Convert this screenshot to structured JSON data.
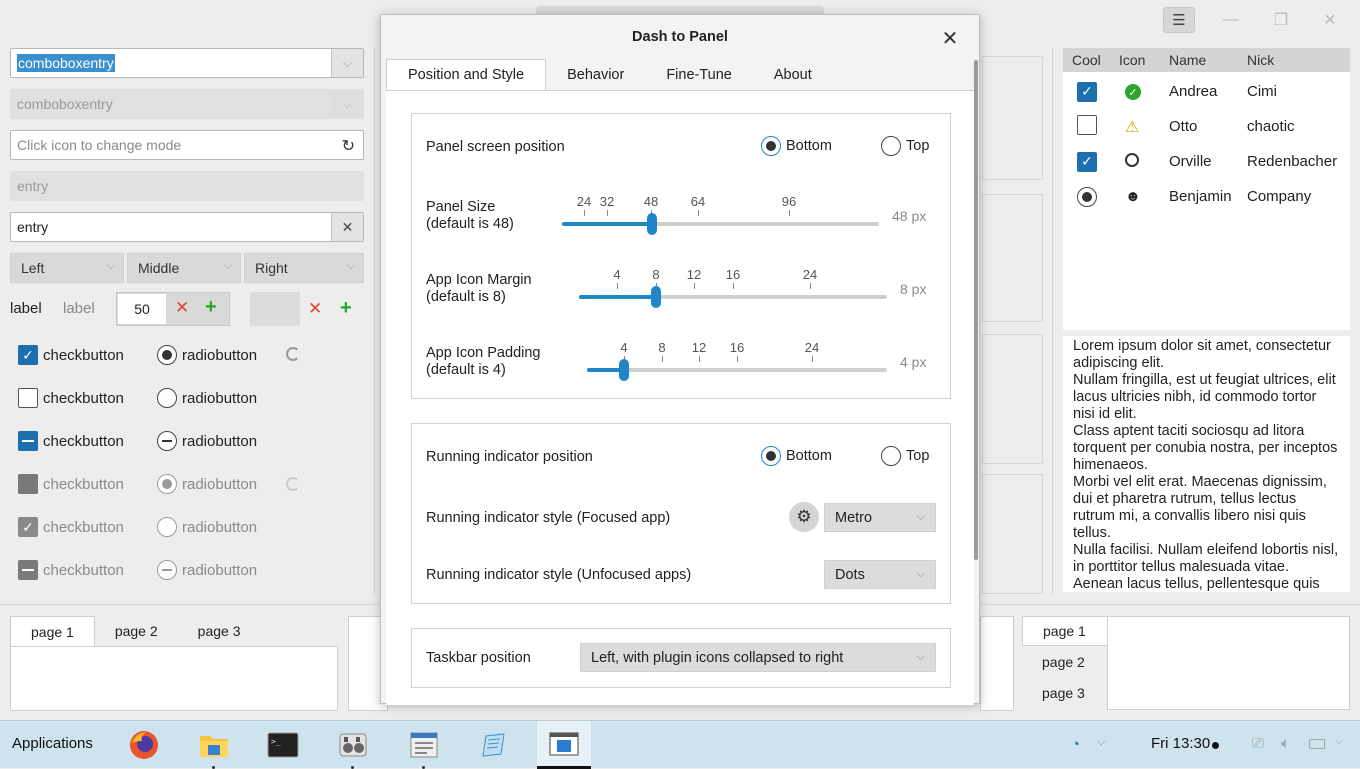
{
  "background_window": {
    "left_panel": {
      "combo_entry_1": "comboboxentry",
      "combo_entry_2": "comboboxentry",
      "mode_entry_placeholder": "Click icon to change mode",
      "entry_disabled": "entry",
      "entry_clear": "entry",
      "segments": [
        "Left",
        "Middle",
        "Right"
      ],
      "label_1": "label",
      "label_2": "label",
      "spin_value": "50",
      "checkbutton_label": "checkbutton",
      "radiobutton_label": "radiobutton"
    },
    "bottom_notebook_left": {
      "tabs": [
        "page 1",
        "page 2",
        "page 3"
      ]
    },
    "bottom_notebook_right": {
      "tabs": [
        "page 1",
        "page 2",
        "page 3"
      ]
    },
    "tree": {
      "columns": [
        "Cool",
        "Icon",
        "Name",
        "Nick"
      ],
      "rows": [
        {
          "name": "Andrea",
          "nick": "Cimi",
          "icon": "ok-icon"
        },
        {
          "name": "Otto",
          "nick": "chaotic",
          "icon": "warning-icon"
        },
        {
          "name": "Orville",
          "nick": "Redenbacher",
          "icon": "user-icon"
        },
        {
          "name": "Benjamin",
          "nick": "Company",
          "icon": "face-icon"
        }
      ]
    },
    "text_view": "Lorem ipsum dolor sit amet, consectetur adipiscing elit.\nNullam fringilla, est ut feugiat ultrices, elit lacus ultricies nibh, id commodo tortor nisi id elit.\nClass aptent taciti sociosqu ad litora torquent per conubia nostra, per inceptos himenaeos.\nMorbi vel elit erat. Maecenas dignissim, dui et pharetra rutrum, tellus lectus rutrum mi, a convallis libero nisi quis tellus.\nNulla facilisi. Nullam eleifend lobortis nisl, in porttitor tellus malesuada vitae.\nAenean lacus tellus, pellentesque quis"
  },
  "dialog": {
    "title": "Dash to Panel",
    "tabs": [
      "Position and Style",
      "Behavior",
      "Fine-Tune",
      "About"
    ],
    "panel_position": {
      "label": "Panel screen position",
      "options": [
        "Bottom",
        "Top"
      ],
      "selected": "Bottom"
    },
    "panel_size": {
      "label_line1": "Panel Size",
      "label_line2": "(default is 48)",
      "ticks": [
        "24",
        "32",
        "48",
        "64",
        "96"
      ],
      "value": 48,
      "value_text": "48 px"
    },
    "icon_margin": {
      "label_line1": "App Icon Margin",
      "label_line2": "(default is 8)",
      "ticks": [
        "4",
        "8",
        "12",
        "16",
        "24"
      ],
      "value": 8,
      "value_text": "8 px"
    },
    "icon_padding": {
      "label_line1": "App Icon Padding",
      "label_line2": "(default is 4)",
      "ticks": [
        "4",
        "8",
        "12",
        "16",
        "24"
      ],
      "value": 4,
      "value_text": "4 px"
    },
    "indicator_position": {
      "label": "Running indicator position",
      "options": [
        "Bottom",
        "Top"
      ],
      "selected": "Bottom"
    },
    "indicator_focused": {
      "label": "Running indicator style (Focused app)",
      "value": "Metro"
    },
    "indicator_unfocused": {
      "label": "Running indicator style (Unfocused apps)",
      "value": "Dots"
    },
    "taskbar_position": {
      "label": "Taskbar position",
      "value": "Left, with plugin icons collapsed to right"
    }
  },
  "taskbar": {
    "applications_label": "Applications",
    "apps": [
      "firefox-icon",
      "files-icon",
      "terminal-icon",
      "settings-icon",
      "text-editor-icon",
      "notes-icon",
      "active-window-icon"
    ],
    "clock": "Fri 13:30"
  }
}
